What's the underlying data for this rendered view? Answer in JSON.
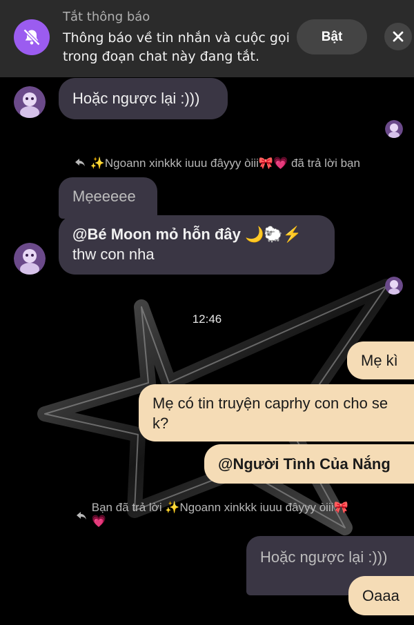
{
  "banner": {
    "title": "Tắt thông báo",
    "text": "Thông báo về tin nhắn và cuộc gọi trong đoạn chat này đang tắt.",
    "button_label": "Bật",
    "icon": "bell-off-icon",
    "close_icon": "close-icon",
    "accent_color": "#9b5cf0"
  },
  "chat": {
    "messages": [
      {
        "text": "Hoặc ngược lại :)))"
      },
      {
        "reply_note": "✨Ngoann xinkkk iuuu đâyyy òiii🎀💗 đã trả lời bạn"
      },
      {
        "quoted": "Mẹeeeee"
      },
      {
        "mention": "@Bé Moon mỏ hỗn đây 🌙🐑⚡",
        "text": "thw con nha"
      },
      {
        "time": "12:46"
      },
      {
        "text": "Mẹ kì"
      },
      {
        "text": "Mẹ có tin truyện caprhy con cho se k?"
      },
      {
        "mention": "@Người Tình Của Nắng"
      },
      {
        "reply_note": "Bạn đã trả lời ✨Ngoann xinkkk iuuu đâyyy òiii🎀",
        "reply_note_line2": "💗"
      },
      {
        "quoted": "Hoặc ngược lại :)))"
      },
      {
        "text": "Oaaa"
      }
    ]
  },
  "colors": {
    "incoming_bubble": "#3a3644",
    "outgoing_bubble": "#f5dcb6",
    "background": "#000000"
  }
}
